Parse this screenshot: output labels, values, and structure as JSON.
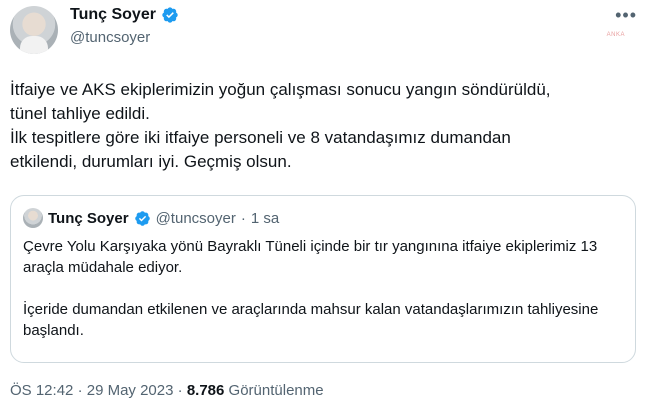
{
  "author": {
    "name": "Tunç Soyer",
    "handle": "@tuncsoyer"
  },
  "menu_label": "•••",
  "watermark_text": "ANKA",
  "tweet": {
    "lines": [
      "İtfaiye ve AKS ekiplerimizin yoğun çalışması sonucu yangın söndürüldü,",
      "tünel tahliye edildi.",
      "İlk tespitlere göre iki itfaiye personeli ve 8 vatandaşımız dumandan",
      "etkilendi, durumları iyi. Geçmiş olsun."
    ]
  },
  "quote": {
    "name": "Tunç Soyer",
    "handle": "@tuncsoyer",
    "separator": "·",
    "time": "1 sa",
    "paragraph1": "Çevre Yolu Karşıyaka yönü Bayraklı Tüneli içinde bir tır yangınına itfaiye ekiplerimiz 13 araçla müdahale ediyor.",
    "paragraph2": "İçeride dumandan etkilenen ve araçlarında mahsur kalan vatandaşlarımızın tahliyesine başlandı."
  },
  "meta": {
    "time": "ÖS 12:42",
    "dot1": "·",
    "date": "29 May 2023",
    "dot2": "·",
    "views": "8.786",
    "views_label": "Görüntülenme"
  },
  "colors": {
    "verified": "#1d9bf0",
    "secondary_text": "#536471",
    "border": "#cfd9de"
  }
}
